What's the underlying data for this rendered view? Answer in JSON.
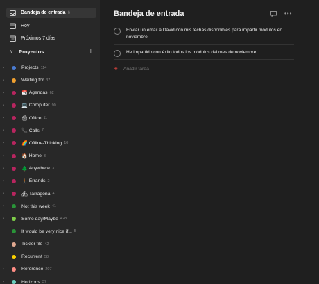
{
  "sidebar": {
    "nav": [
      {
        "label": "Bandeja de entrada",
        "badge": "6",
        "icon": "inbox-icon"
      },
      {
        "label": "Hoy",
        "badge": "",
        "icon": "calendar-today-icon"
      },
      {
        "label": "Próximos 7 días",
        "badge": "",
        "icon": "calendar-week-icon"
      }
    ],
    "projects_label": "Proyectos",
    "projects": [
      {
        "name": "Projects",
        "count": "114",
        "color": "#4a7bd0",
        "emoji": "",
        "expand": true
      },
      {
        "name": "Waiting for",
        "count": "37",
        "color": "#f0a030",
        "emoji": "",
        "expand": true
      },
      {
        "name": "Agendas",
        "count": "62",
        "color": "#b8255f",
        "emoji": "📅",
        "expand": true
      },
      {
        "name": "Computer",
        "count": "90",
        "color": "#b8255f",
        "emoji": "💻",
        "expand": true
      },
      {
        "name": "Office",
        "count": "11",
        "color": "#b8255f",
        "emoji": "🖨",
        "expand": true
      },
      {
        "name": "Calls",
        "count": "7",
        "color": "#b8255f",
        "emoji": "📞",
        "expand": true
      },
      {
        "name": "Offline-Thinking",
        "count": "10",
        "color": "#b8255f",
        "emoji": "🌈",
        "expand": true
      },
      {
        "name": "Home",
        "count": "3",
        "color": "#b8255f",
        "emoji": "🏠",
        "expand": true
      },
      {
        "name": "Anywhere",
        "count": "3",
        "color": "#b8255f",
        "emoji": "🌲",
        "expand": true
      },
      {
        "name": "Errands",
        "count": "2",
        "color": "#b8255f",
        "emoji": "🚶",
        "expand": true
      },
      {
        "name": "Tarragona",
        "count": "4",
        "color": "#b8255f",
        "emoji": "🏘",
        "expand": true
      },
      {
        "name": "Not this week",
        "count": "41",
        "color": "#299438",
        "emoji": "",
        "expand": true
      },
      {
        "name": "Some day/Maybe",
        "count": "428",
        "color": "#7ecc49",
        "emoji": "",
        "expand": true
      },
      {
        "name": "It would be very nice if...",
        "count": "5",
        "color": "#299438",
        "emoji": "",
        "expand": false
      },
      {
        "name": "Tickler file",
        "count": "42",
        "color": "#e0a890",
        "emoji": "",
        "expand": false
      },
      {
        "name": "Recurrent",
        "count": "58",
        "color": "#fad000",
        "emoji": "",
        "expand": false
      },
      {
        "name": "Reference",
        "count": "207",
        "color": "#ff8d85",
        "emoji": "",
        "expand": true
      },
      {
        "name": "Horizons",
        "count": "37",
        "color": "#6accbc",
        "emoji": "",
        "expand": true
      }
    ]
  },
  "main": {
    "title": "Bandeja de entrada",
    "tasks": [
      {
        "text": "Enviar un email a David con mis fechas disponibles para impartir módulos en noviembre"
      },
      {
        "text": "He impartido con éxito todos los módulos del mes de noviembre"
      }
    ],
    "add_task_label": "Añadir tarea"
  }
}
